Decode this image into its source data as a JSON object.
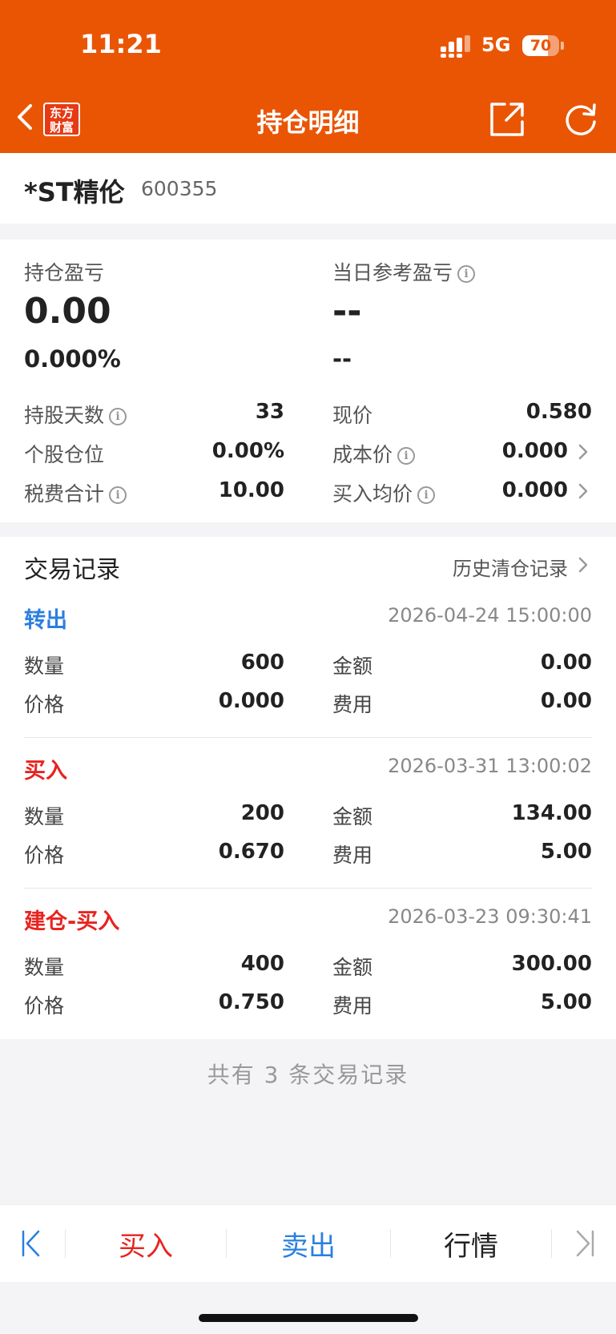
{
  "status": {
    "time": "11:21",
    "network": "5G",
    "battery": "70",
    "battery_level": 0.7
  },
  "nav": {
    "title": "持仓明细",
    "logo_line1": "东方",
    "logo_line2": "财富"
  },
  "stock": {
    "name": "*ST精伦",
    "code": "600355"
  },
  "summary": {
    "pnl_label": "持仓盈亏",
    "pnl_value": "0.00",
    "pnl_pct": "0.000%",
    "daily_label": "当日参考盈亏",
    "daily_value": "--",
    "daily_pct": "--",
    "rows": [
      {
        "l_label": "持股天数",
        "l_value": "33",
        "r_label": "现价",
        "r_value": "0.580"
      },
      {
        "l_label": "个股仓位",
        "l_value": "0.00%",
        "r_label": "成本价",
        "r_value": "0.000"
      },
      {
        "l_label": "税费合计",
        "l_value": "10.00",
        "r_label": "买入均价",
        "r_value": "0.000"
      }
    ]
  },
  "records": {
    "title": "交易记录",
    "history_link": "历史清仓记录",
    "labels": {
      "qty": "数量",
      "amount": "金额",
      "price": "价格",
      "fee": "费用"
    },
    "items": [
      {
        "type": "转出",
        "type_color": "#2a7fde",
        "time": "2026-04-24 15:00:00",
        "qty": "600",
        "amount": "0.00",
        "price": "0.000",
        "fee": "0.00"
      },
      {
        "type": "买入",
        "type_color": "#e8231f",
        "time": "2026-03-31 13:00:02",
        "qty": "200",
        "amount": "134.00",
        "price": "0.670",
        "fee": "5.00"
      },
      {
        "type": "建仓-买入",
        "type_color": "#e8231f",
        "time": "2026-03-23 09:30:41",
        "qty": "400",
        "amount": "300.00",
        "price": "0.750",
        "fee": "5.00"
      }
    ],
    "footer": "共有 3 条交易记录"
  },
  "bottom_bar": {
    "buy": "买入",
    "sell": "卖出",
    "market": "行情",
    "buy_color": "#e8231f",
    "sell_color": "#2a7fde"
  },
  "colors": {
    "brand": "#ea5504"
  }
}
